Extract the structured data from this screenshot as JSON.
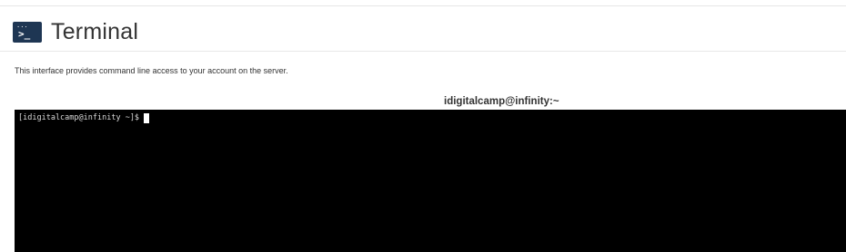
{
  "header": {
    "icon": "terminal-icon",
    "icon_dots": "...",
    "icon_glyph": ">_",
    "title": "Terminal"
  },
  "description": "This interface provides command line access to your account on the server.",
  "session": {
    "title": "idigitalcamp@infinity:~",
    "prompt": "[idigitalcamp@infinity ~]$"
  },
  "colors": {
    "icon_background": "#1e3653",
    "console_background": "#000000",
    "console_text": "#d8d8d8",
    "cursor": "#ffffff",
    "title_text": "#333333"
  }
}
